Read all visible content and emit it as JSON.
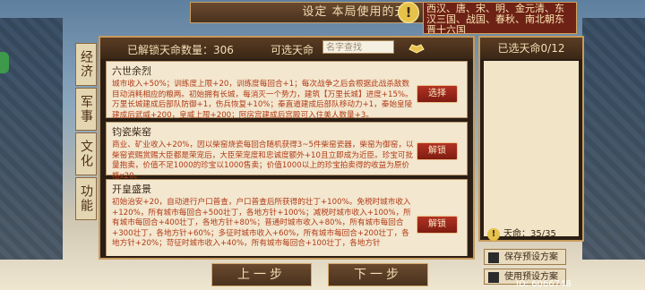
{
  "title": "设定 本局使用的天命",
  "dynasties": "西汉、唐、宋、明、金元清、东汉三国、战国、春秋、南北朝东晋十六国",
  "tabs": [
    "经济",
    "军事",
    "文化",
    "功能"
  ],
  "header": {
    "unlocked_label": "已解锁天命数量：",
    "unlocked_count": "306",
    "selectable": "可选天命",
    "search_placeholder": "名字查找"
  },
  "cards": [
    {
      "name": "六世余烈",
      "desc": "城市收入+50%；训练度上限+20，训练度每回合+1；每次战争之后会根据此战杀敌数目动消耗相应的粮两。初始拥有长城，每消灭一个势力，建筑【万里长城】进度+15%。万里长城建成后部队防御+1，伤兵恢复+10%；秦直道建成后部队移动力+1，秦始皇陵建成后武威+200，皇威上限+200；阿房宫建成后宫殿可入住美人数量+3。",
      "button": "选择"
    },
    {
      "name": "钧瓷柴窑",
      "desc": "商业、矿业收入+20%，因以柴窑烧瓷每回合随机获得3~5件柴窑瓷器，柴窑为御窑，以柴窑瓷赐赏赐大臣都是荣宠后，大臣荣宠度和忠诚度额外+10且立即成为近臣。珍宝可批量抱卖，价值不足1000的珍宝以1000售卖；价值1000以上的珍宝拍卖得的收益为原价格x20。",
      "button": "解锁"
    },
    {
      "name": "开皇盛景",
      "desc": "初始治安+20，自动进行户口普查，户口普查后所获得的壮丁+100%。免税时城市收入+120%，所有城市每回合+500壮丁，各地方针+100%；减税时城市收入+100%，所有城市每回合+400壮丁，各地方针+80%；普通时城市收入+80%，所有城市每回合+300壮丁，各地方针+60%；多征时城市收入+60%，所有城市每回合+200壮丁，各地方针+20%；苛征时城市收入+40%，所有城市每回合+100壮丁，各地方针",
      "button": "解锁"
    }
  ],
  "right_panel": {
    "title": "已选天命0/12",
    "tianming_label": "天命：",
    "tianming_value": "35/35"
  },
  "nav": {
    "prev": "上一步",
    "next": "下一步"
  },
  "side_buttons": {
    "save": "保存预设方案",
    "use": "使用预设方案"
  },
  "uid": "ID: 6066748"
}
